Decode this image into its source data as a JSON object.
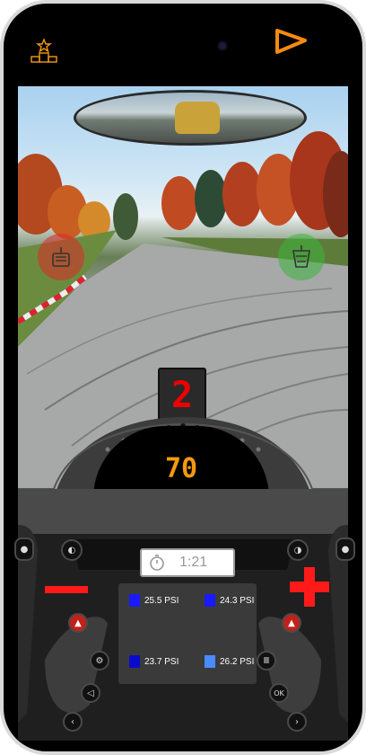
{
  "top_bar": {
    "leaderboard_icon": "podium-icon",
    "play_icon": "play-icon"
  },
  "hud": {
    "gear": "2",
    "speed": "70",
    "lap_time": "1:21"
  },
  "tires": [
    {
      "label": "25.5 PSI",
      "color": "#1a1aff"
    },
    {
      "label": "24.3 PSI",
      "color": "#1a1aff"
    },
    {
      "label": "23.7 PSI",
      "color": "#0a0acc"
    },
    {
      "label": "26.2 PSI",
      "color": "#4a8cff"
    }
  ],
  "controls": {
    "minus_color": "#ff1a1a",
    "plus_color": "#ff1a1a",
    "accent": "#f59a10"
  }
}
